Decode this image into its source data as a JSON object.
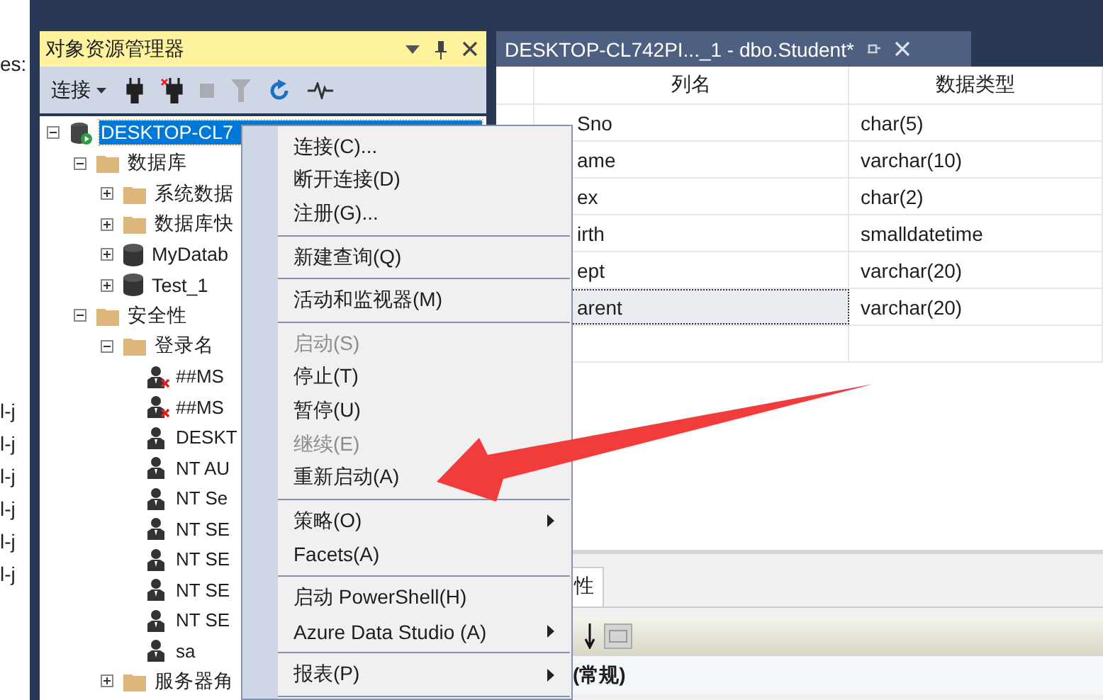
{
  "background_window": {
    "top_text": "es:",
    "lines": [
      "l-j",
      "l-j",
      "l-j",
      "l-j",
      "l-j",
      "l-j"
    ]
  },
  "object_explorer": {
    "title": "对象资源管理器",
    "toolbar": {
      "connect_label": "连接"
    },
    "tree": [
      {
        "kind": "server",
        "label": "DESKTOP-CL7",
        "expanded": true,
        "selected": true,
        "children": [
          {
            "kind": "folder",
            "label": "数据库",
            "expanded": true,
            "selected": false,
            "children": [
              {
                "kind": "folder",
                "label": "系统数据",
                "expanded": false,
                "selected": false
              },
              {
                "kind": "folder",
                "label": "数据库快",
                "expanded": false,
                "selected": false
              },
              {
                "kind": "database",
                "label": "MyDatab",
                "expanded": false,
                "selected": false
              },
              {
                "kind": "database",
                "label": "Test_1",
                "expanded": false,
                "selected": false
              }
            ]
          },
          {
            "kind": "folder",
            "label": "安全性",
            "expanded": true,
            "selected": false,
            "children": [
              {
                "kind": "folder",
                "label": "登录名",
                "expanded": true,
                "selected": false,
                "children": [
                  {
                    "kind": "login",
                    "label": "##MS",
                    "disabled": true,
                    "selected": false
                  },
                  {
                    "kind": "login",
                    "label": "##MS",
                    "disabled": true,
                    "selected": false
                  },
                  {
                    "kind": "login",
                    "label": "DESKT",
                    "disabled": false,
                    "selected": false
                  },
                  {
                    "kind": "login",
                    "label": "NT AU",
                    "disabled": false,
                    "selected": false
                  },
                  {
                    "kind": "login",
                    "label": "NT Se",
                    "disabled": false,
                    "selected": false
                  },
                  {
                    "kind": "login",
                    "label": "NT SE",
                    "disabled": false,
                    "selected": false
                  },
                  {
                    "kind": "login",
                    "label": "NT SE",
                    "disabled": false,
                    "selected": false
                  },
                  {
                    "kind": "login",
                    "label": "NT SE",
                    "disabled": false,
                    "selected": false
                  },
                  {
                    "kind": "login",
                    "label": "NT SE",
                    "disabled": false,
                    "selected": false
                  },
                  {
                    "kind": "login",
                    "label": "sa",
                    "disabled": false,
                    "selected": false
                  }
                ]
              },
              {
                "kind": "folder",
                "label": "服务器角",
                "expanded": false,
                "selected": false
              }
            ]
          }
        ]
      }
    ]
  },
  "document_tab": {
    "title": "DESKTOP-CL742PI..._1 - dbo.Student*",
    "selected": true
  },
  "table": {
    "columns": [
      "列名",
      "数据类型"
    ],
    "rows": [
      {
        "name": "Sno",
        "type": "char(5)",
        "selected": false
      },
      {
        "name": "ame",
        "type": "varchar(10)",
        "selected": false
      },
      {
        "name": "ex",
        "type": "char(2)",
        "selected": false
      },
      {
        "name": "irth",
        "type": "smalldatetime",
        "selected": false
      },
      {
        "name": "ept",
        "type": "varchar(20)",
        "selected": false
      },
      {
        "name": "arent",
        "type": "varchar(20)",
        "selected": true
      },
      {
        "name": "",
        "type": "",
        "selected": false
      }
    ]
  },
  "properties": {
    "tab_label": "性",
    "category": "(常规)"
  },
  "context_menu": [
    {
      "kind": "item",
      "label": "连接(C)...",
      "disabled": false,
      "submenu": false
    },
    {
      "kind": "item",
      "label": "断开连接(D)",
      "disabled": false,
      "submenu": false
    },
    {
      "kind": "item",
      "label": "注册(G)...",
      "disabled": false,
      "submenu": false
    },
    {
      "kind": "separator"
    },
    {
      "kind": "item",
      "label": "新建查询(Q)",
      "disabled": false,
      "submenu": false
    },
    {
      "kind": "separator"
    },
    {
      "kind": "item",
      "label": "活动和监视器(M)",
      "disabled": false,
      "submenu": false
    },
    {
      "kind": "separator"
    },
    {
      "kind": "item",
      "label": "启动(S)",
      "disabled": true,
      "submenu": false
    },
    {
      "kind": "item",
      "label": "停止(T)",
      "disabled": false,
      "submenu": false
    },
    {
      "kind": "item",
      "label": "暂停(U)",
      "disabled": false,
      "submenu": false
    },
    {
      "kind": "item",
      "label": "继续(E)",
      "disabled": true,
      "submenu": false
    },
    {
      "kind": "item",
      "label": "重新启动(A)",
      "disabled": false,
      "submenu": false
    },
    {
      "kind": "separator"
    },
    {
      "kind": "item",
      "label": "策略(O)",
      "disabled": false,
      "submenu": true
    },
    {
      "kind": "item",
      "label": "Facets(A)",
      "disabled": false,
      "submenu": false
    },
    {
      "kind": "separator"
    },
    {
      "kind": "item",
      "label": "启动 PowerShell(H)",
      "disabled": false,
      "submenu": false
    },
    {
      "kind": "item",
      "label": "Azure Data Studio (A)",
      "disabled": false,
      "submenu": true
    },
    {
      "kind": "separator"
    },
    {
      "kind": "item",
      "label": "报表(P)",
      "disabled": false,
      "submenu": true
    },
    {
      "kind": "separator"
    }
  ]
}
